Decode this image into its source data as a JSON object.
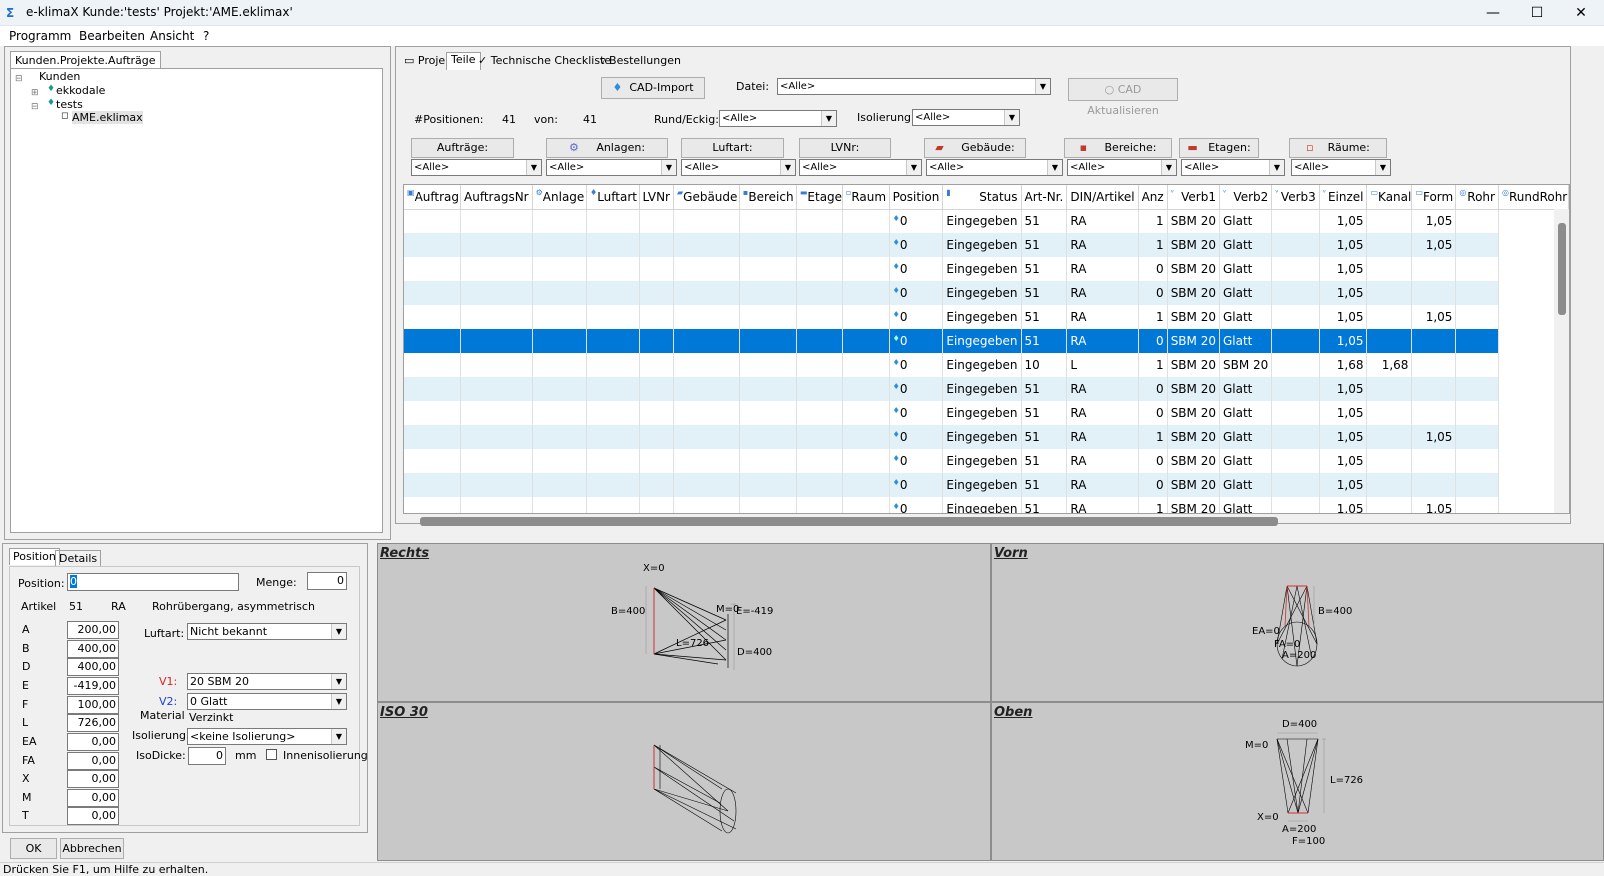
{
  "window": {
    "title": "e-klimaX  Kunde:'tests'  Projekt:'AME.eklimax'"
  },
  "menu": [
    "Programm",
    "Bearbeiten",
    "Ansicht",
    "?"
  ],
  "left_tab": "Kunden.Projekte.Aufträge",
  "tree": {
    "root": "Kunden",
    "items": [
      "ekkodale",
      "tests"
    ],
    "child": "AME.eklimax"
  },
  "tabs": [
    "Projekt",
    "Teile",
    "Technische Checkliste",
    "Bestellungen"
  ],
  "toolbar": {
    "cad_import": "CAD-Import",
    "datei_label": "Datei:",
    "datei_value": "<Alle>",
    "cad_update": "CAD Aktualisieren",
    "positionen_label": "#Positionen:",
    "positionen_value": "41",
    "von_label": "von:",
    "von_value": "41",
    "rund_label": "Rund/Eckig:",
    "rund_value": "<Alle>",
    "iso_label": "Isolierung:",
    "iso_value": "<Alle>"
  },
  "filters": [
    {
      "label": "Aufträge:",
      "value": "<Alle>"
    },
    {
      "label": "Anlagen:",
      "value": "<Alle>"
    },
    {
      "label": "Luftart:",
      "value": "<Alle>"
    },
    {
      "label": "LVNr:",
      "value": "<Alle>"
    },
    {
      "label": "Gebäude:",
      "value": "<Alle>"
    },
    {
      "label": "Bereiche:",
      "value": "<Alle>"
    },
    {
      "label": "Etagen:",
      "value": "<Alle>"
    },
    {
      "label": "Räume:",
      "value": "<Alle>"
    }
  ],
  "grid": {
    "columns": [
      "Auftrag",
      "AuftragsNr",
      "Anlage",
      "Luftart",
      "LVNr",
      "Gebäude",
      "Bereich",
      "Etage",
      "Raum",
      "Position",
      "Status",
      "Art-Nr.",
      "DIN/Artikel",
      "Anz",
      "Verb1",
      "Verb2",
      "Verb3",
      "Einzel",
      "Kanal",
      "Form",
      "Rohr",
      "RundRohr"
    ],
    "rows": [
      [
        "0",
        "Eingegeben",
        "51",
        "RA",
        "1",
        "SBM 20",
        "Glatt",
        "",
        "1,05",
        "",
        "1,05"
      ],
      [
        "0",
        "Eingegeben",
        "51",
        "RA",
        "1",
        "SBM 20",
        "Glatt",
        "",
        "1,05",
        "",
        "1,05"
      ],
      [
        "0",
        "Eingegeben",
        "51",
        "RA",
        "0",
        "SBM 20",
        "Glatt",
        "",
        "1,05",
        "",
        ""
      ],
      [
        "0",
        "Eingegeben",
        "51",
        "RA",
        "0",
        "SBM 20",
        "Glatt",
        "",
        "1,05",
        "",
        ""
      ],
      [
        "0",
        "Eingegeben",
        "51",
        "RA",
        "1",
        "SBM 20",
        "Glatt",
        "",
        "1,05",
        "",
        "1,05"
      ],
      [
        "0",
        "Eingegeben",
        "51",
        "RA",
        "0",
        "SBM 20",
        "Glatt",
        "",
        "1,05",
        "",
        ""
      ],
      [
        "0",
        "Eingegeben",
        "10",
        "L",
        "1",
        "SBM 20",
        "SBM 20",
        "",
        "1,68",
        "1,68",
        ""
      ],
      [
        "0",
        "Eingegeben",
        "51",
        "RA",
        "0",
        "SBM 20",
        "Glatt",
        "",
        "1,05",
        "",
        ""
      ],
      [
        "0",
        "Eingegeben",
        "51",
        "RA",
        "0",
        "SBM 20",
        "Glatt",
        "",
        "1,05",
        "",
        ""
      ],
      [
        "0",
        "Eingegeben",
        "51",
        "RA",
        "1",
        "SBM 20",
        "Glatt",
        "",
        "1,05",
        "",
        "1,05"
      ],
      [
        "0",
        "Eingegeben",
        "51",
        "RA",
        "0",
        "SBM 20",
        "Glatt",
        "",
        "1,05",
        "",
        ""
      ],
      [
        "0",
        "Eingegeben",
        "51",
        "RA",
        "0",
        "SBM 20",
        "Glatt",
        "",
        "1,05",
        "",
        ""
      ],
      [
        "0",
        "Eingegeben",
        "51",
        "RA",
        "1",
        "SBM 20",
        "Glatt",
        "",
        "1,05",
        "",
        "1,05"
      ]
    ],
    "selected_row": 5
  },
  "detail": {
    "tabs": [
      "Position",
      "Details"
    ],
    "position_label": "Position:",
    "position_value": "0",
    "menge_label": "Menge:",
    "menge_value": "0",
    "artikel_label": "Artikel",
    "artikel_nr": "51",
    "artikel_code": "RA",
    "artikel_name": "Rohrübergang, asymmetrisch",
    "params": [
      {
        "k": "A",
        "v": "200,00"
      },
      {
        "k": "B",
        "v": "400,00"
      },
      {
        "k": "D",
        "v": "400,00"
      },
      {
        "k": "E",
        "v": "-419,00"
      },
      {
        "k": "F",
        "v": "100,00"
      },
      {
        "k": "L",
        "v": "726,00"
      },
      {
        "k": "EA",
        "v": "0,00"
      },
      {
        "k": "FA",
        "v": "0,00"
      },
      {
        "k": "X",
        "v": "0,00"
      },
      {
        "k": "M",
        "v": "0,00"
      },
      {
        "k": "T",
        "v": "0,00"
      }
    ],
    "luftart_label": "Luftart:",
    "luftart_value": "Nicht bekannt",
    "v1_label": "V1:",
    "v1_value": "20 SBM 20",
    "v2_label": "V2:",
    "v2_value": "0 Glatt",
    "material_label": "Material",
    "material_value": "Verzinkt",
    "iso_label": "Isolierung:",
    "iso_value": "<keine Isolierung>",
    "isodicke_label": "IsoDicke:",
    "isodicke_value": "0",
    "mm": "mm",
    "innen": "Innenisolierung",
    "ok": "OK",
    "abbrechen": "Abbrechen"
  },
  "views": {
    "rechts": {
      "title": "Rechts",
      "labels": [
        "X=0",
        "B=400",
        "M=0",
        "E=-419",
        "L=726",
        "D=400"
      ]
    },
    "vorn": {
      "title": "Vorn",
      "labels": [
        "B=400",
        "EA=0",
        "FA=0",
        "A=200"
      ]
    },
    "iso": {
      "title": "ISO 30"
    },
    "oben": {
      "title": "Oben",
      "labels": [
        "D=400",
        "M=0",
        "L=726",
        "X=0",
        "A=200",
        "F=100"
      ]
    }
  },
  "status": "Drücken Sie F1, um Hilfe zu erhalten.",
  "colors": {
    "selection": "#0078d7",
    "alt_row": "#e2f1f8",
    "v1": "#e02020",
    "v2": "#2040d0"
  }
}
